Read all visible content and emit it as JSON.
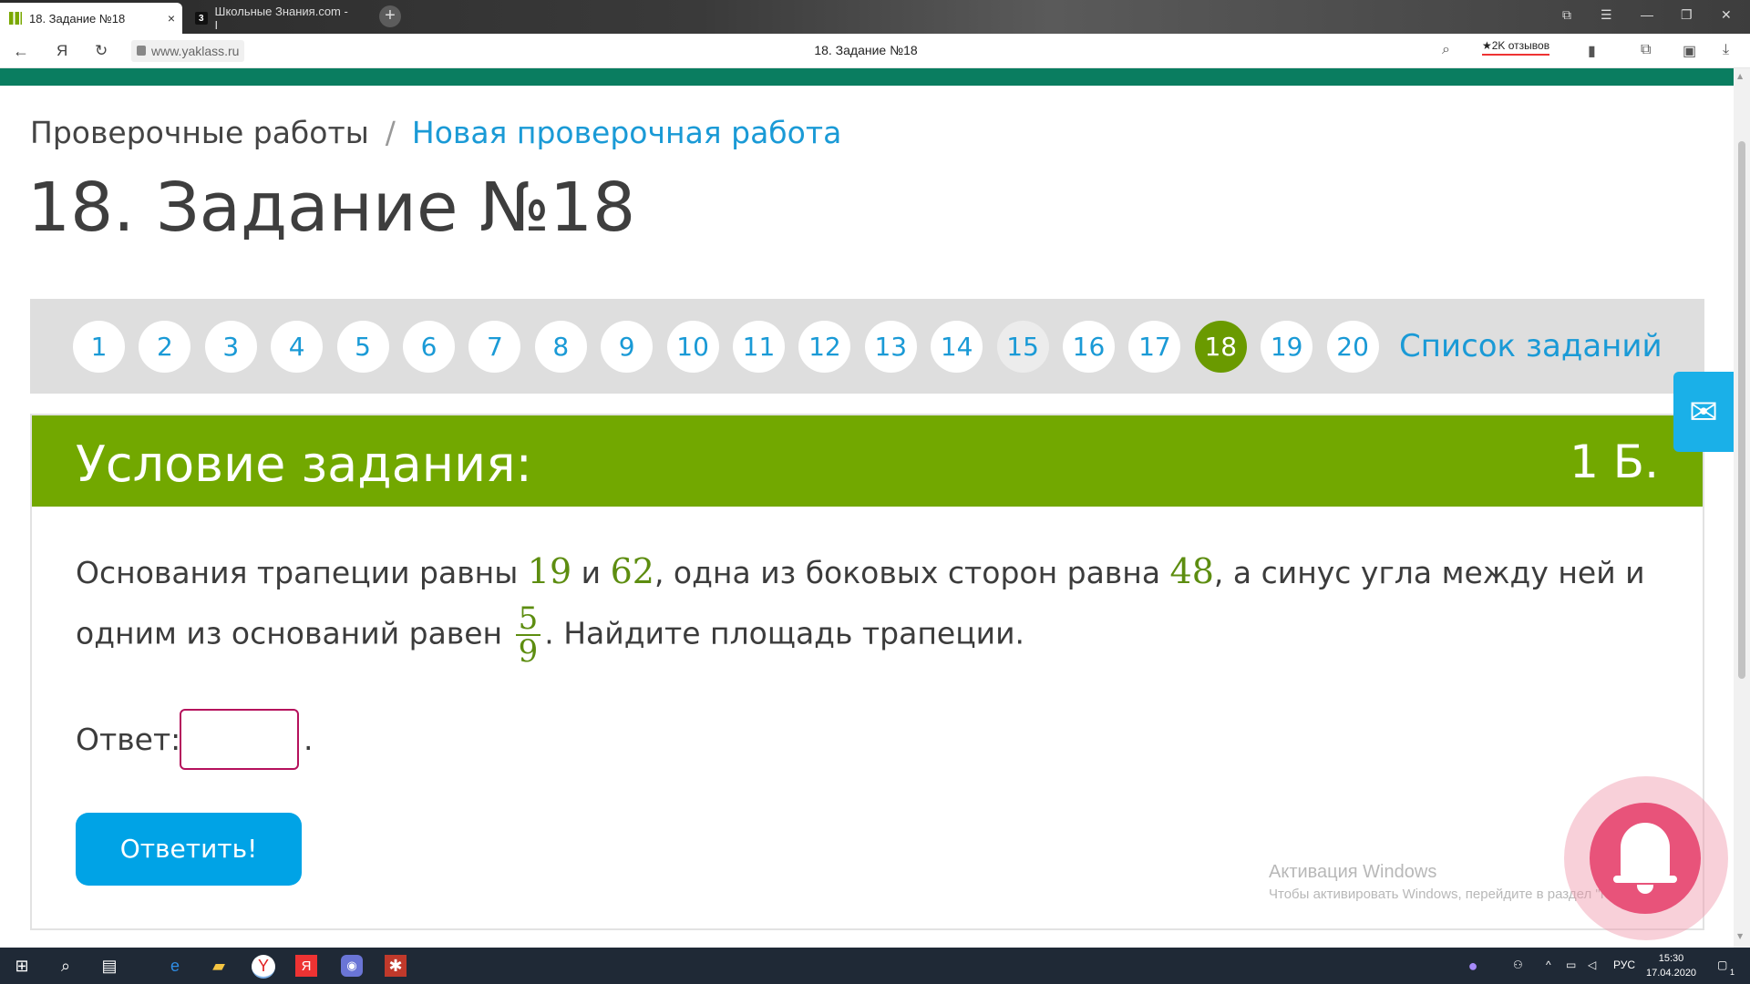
{
  "browser": {
    "tabs": [
      {
        "title": "18. Задание №18",
        "active": true,
        "close": "×"
      },
      {
        "title": "Школьные Знания.com - I",
        "active": false,
        "favicon": "3"
      }
    ],
    "new_tab": "+",
    "url": "www.yaklass.ru",
    "page_title": "18. Задание №18",
    "reviews": "★2K отзывов",
    "icons": [
      "back-icon",
      "yandex-icon",
      "reload-icon",
      "lock-icon",
      "search-icon",
      "bookmark-icon",
      "collections-icon",
      "protect-icon",
      "download-icon"
    ],
    "window_controls": [
      "pin-icon",
      "menu-icon",
      "minimize-icon",
      "restore-icon",
      "close-icon"
    ]
  },
  "breadcrumb": {
    "parent": "Проверочные работы",
    "separator": "/",
    "current": "Новая проверочная работа"
  },
  "heading": "18. Задание №18",
  "task_nav": {
    "numbers": [
      "1",
      "2",
      "3",
      "4",
      "5",
      "6",
      "7",
      "8",
      "9",
      "10",
      "11",
      "12",
      "13",
      "14",
      "15",
      "16",
      "17",
      "18",
      "19",
      "20"
    ],
    "current": "18",
    "done": [
      "15"
    ],
    "list_link": "Список заданий"
  },
  "task": {
    "title": "Условие задания:",
    "points": "1 Б.",
    "text_1": "Основания трапеции равны ",
    "num_a": "19",
    "text_2": " и ",
    "num_b": "62",
    "text_3": ", одна из боковых сторон равна ",
    "num_c": "48",
    "text_4": ", а синус угла между ней и одним из оснований равен ",
    "frac_num": "5",
    "frac_den": "9",
    "text_5": ". Найдите площадь трапеции.",
    "answer_label": "Ответ:",
    "answer_value": "",
    "answer_suffix": ".",
    "submit_label": "Ответить!"
  },
  "feedback_icon": "mail-icon",
  "activation": {
    "line1": "Активация Windows",
    "line2": "Чтобы активировать Windows, перейдите в раздел \"Параметры\"."
  },
  "taskbar": {
    "language": "РУС",
    "time": "15:30",
    "date": "17.04.2020",
    "notifications": "1"
  },
  "colors": {
    "accent_green": "#72a800",
    "current_task": "#6a9a00",
    "link_blue": "#1a9ad6",
    "submit_blue": "#00a3e6",
    "input_border": "#b5115c",
    "site_top_strip": "#0a7d60"
  }
}
